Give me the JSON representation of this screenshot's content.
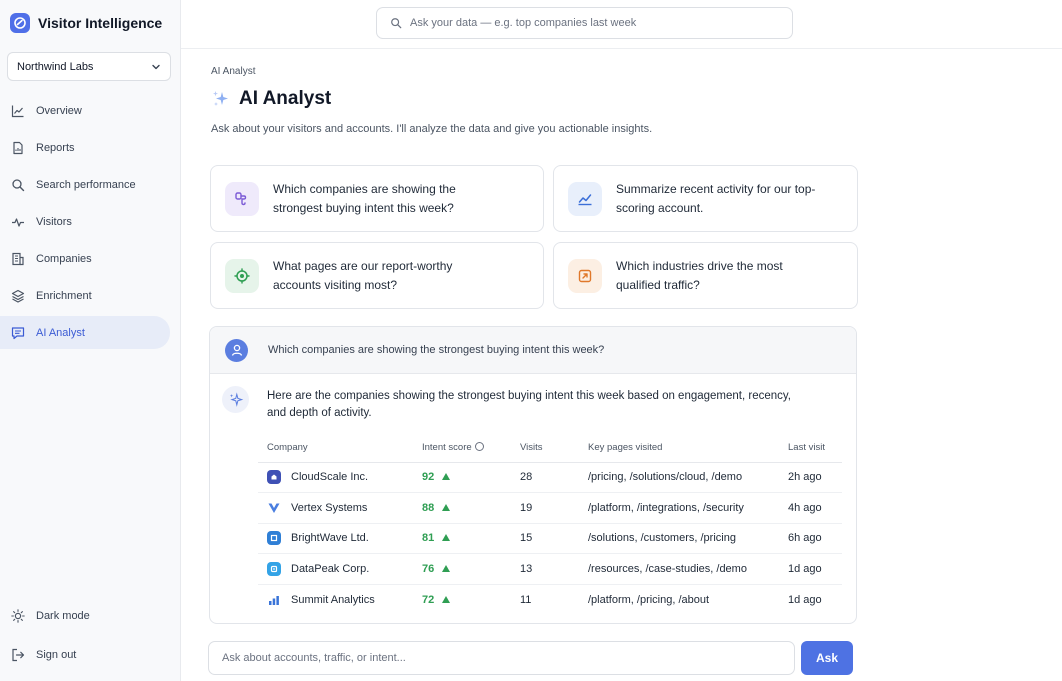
{
  "app": {
    "title": "Visitor Intelligence",
    "workspace": "Northwind Labs"
  },
  "search": {
    "placeholder": "Ask your data — e.g. top companies last week"
  },
  "sidebar": {
    "items": [
      {
        "label": "Overview",
        "icon": "line-chart-icon"
      },
      {
        "label": "Reports",
        "icon": "document-icon"
      },
      {
        "label": "Search performance",
        "icon": "search-icon"
      },
      {
        "label": "Visitors",
        "icon": "activity-icon"
      },
      {
        "label": "Companies",
        "icon": "building-icon"
      },
      {
        "label": "Enrichment",
        "icon": "layers-icon"
      },
      {
        "label": "AI Analyst",
        "icon": "chat-icon",
        "active": true
      }
    ],
    "bottom": [
      {
        "label": "Dark mode",
        "icon": "sun-icon"
      },
      {
        "label": "Sign out",
        "icon": "sign-out-icon"
      }
    ]
  },
  "page": {
    "breadcrumb": "AI Analyst",
    "title": "AI Analyst",
    "subtitle": "Ask about your visitors and accounts. I'll analyze the data and give you actionable insights."
  },
  "suggestions": [
    {
      "text": "Which companies are showing the strongest buying intent this week?",
      "icon": "intent-icon",
      "color": "#7c5bd6",
      "bg": "#efeafb"
    },
    {
      "text": "Summarize recent activity for our top-scoring account.",
      "icon": "trend-chart-icon",
      "color": "#3b6fd8",
      "bg": "#e8effb"
    },
    {
      "text": "What pages are our report-worthy accounts visiting most?",
      "icon": "pages-icon",
      "color": "#2f9e53",
      "bg": "#e6f4ea"
    },
    {
      "text": "Which industries drive the most qualified traffic?",
      "icon": "industry-icon",
      "color": "#e0782a",
      "bg": "#fcefe3"
    }
  ],
  "chat": {
    "question": "Which companies are showing the strongest buying intent this week?",
    "answer": "Here are the companies showing the strongest buying intent this week based on engagement, recency, and depth of activity.",
    "table": {
      "headers": [
        "Company",
        "Intent score",
        "Visits",
        "Key pages visited",
        "Last visit"
      ],
      "rows": [
        {
          "company": "CloudScale Inc.",
          "score": "92",
          "visits": "28",
          "pages": "/pricing, /solutions/cloud, /demo",
          "last": "2h ago",
          "logo_color": "#3f51b5"
        },
        {
          "company": "Vertex Systems",
          "score": "88",
          "visits": "19",
          "pages": "/platform, /integrations, /security",
          "last": "4h ago",
          "logo_color": "#4a7ee0"
        },
        {
          "company": "BrightWave Ltd.",
          "score": "81",
          "visits": "15",
          "pages": "/solutions, /customers, /pricing",
          "last": "6h ago",
          "logo_color": "#2f7fd6"
        },
        {
          "company": "DataPeak Corp.",
          "score": "76",
          "visits": "13",
          "pages": "/resources, /case-studies, /demo",
          "last": "1d ago",
          "logo_color": "#33a3e6"
        },
        {
          "company": "Summit Analytics",
          "score": "72",
          "visits": "11",
          "pages": "/platform, /pricing, /about",
          "last": "1d ago",
          "logo_color": "#3a74d8"
        }
      ]
    }
  },
  "composer": {
    "placeholder": "Ask about accounts, traffic, or intent...",
    "button": "Ask"
  },
  "colors": {
    "accent": "#4e72e3",
    "positive": "#2f9e53",
    "active_nav_bg": "#e7ecf8"
  }
}
